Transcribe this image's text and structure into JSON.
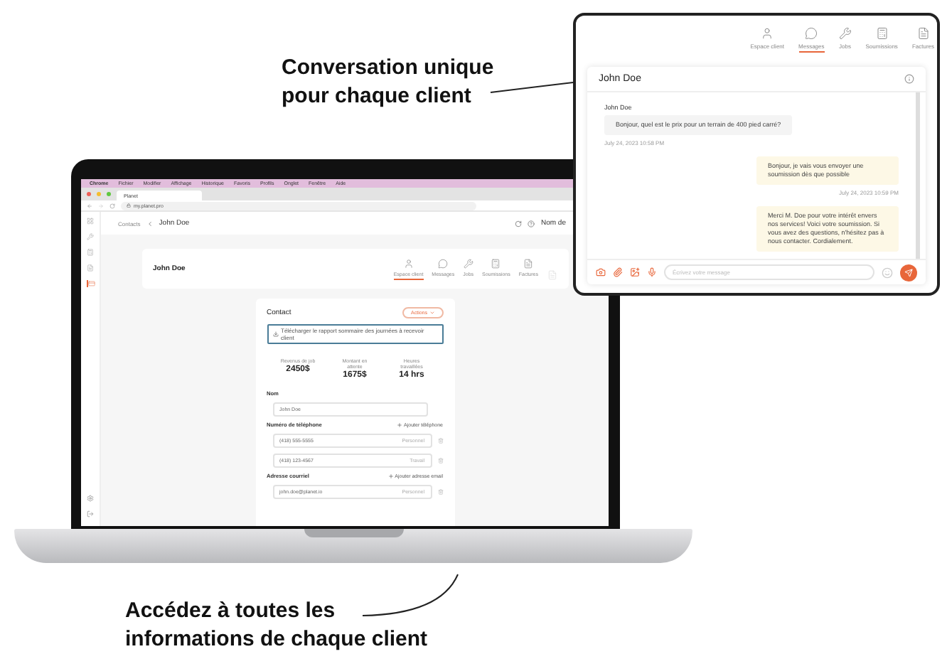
{
  "top_caption": {
    "lines": [
      "Conversation unique",
      "pour chaque client"
    ]
  },
  "bottom_caption": {
    "lines": [
      "Accédez à toutes les",
      "informations de chaque client"
    ]
  },
  "laptop": {
    "menu_bar": {
      "app": "Chrome",
      "items": [
        "Fichier",
        "Modifier",
        "Affichage",
        "Historique",
        "Favoris",
        "Profils",
        "Onglet",
        "Fenêtre",
        "Aide"
      ]
    },
    "browser_tab": {
      "title": "Planet"
    },
    "address": "my.planet.pro",
    "breadcrumb": {
      "parent": "Contacts",
      "current": "John Doe",
      "account": "Nom de"
    },
    "sidebar": [
      {
        "kind": "grid",
        "selected": false
      },
      {
        "kind": "tools",
        "selected": false
      },
      {
        "kind": "calc",
        "selected": false
      },
      {
        "kind": "file",
        "selected": false
      },
      {
        "kind": "card",
        "selected": true
      }
    ],
    "client_name": "John Doe",
    "tabs": [
      {
        "label": "Espace client",
        "kind": "user",
        "selected": true
      },
      {
        "label": "Messages",
        "kind": "chat",
        "selected": false
      },
      {
        "label": "Jobs",
        "kind": "tools",
        "selected": false
      },
      {
        "label": "Soumissions",
        "kind": "calc",
        "selected": false
      },
      {
        "label": "Factures",
        "kind": "file",
        "selected": false
      }
    ],
    "contact": {
      "title": "Contact",
      "actions": "Actions",
      "download": "Télécharger le rapport sommaire des journées à recevoir client",
      "stats": [
        {
          "label": "Revenus de job",
          "value": "2450$"
        },
        {
          "label": "Montant en attente",
          "value": "1675$"
        },
        {
          "label": "Heures travaillées",
          "value": "14 hrs"
        }
      ],
      "name_label": "Nom",
      "name_value": "John Doe",
      "phone_label": "Numéro de téléphone",
      "phone_add": "Ajouter téléphone",
      "phones": [
        {
          "value": "(418) 555-5555",
          "type": "Personnel"
        },
        {
          "value": "(418) 123-4567",
          "type": "Travail"
        }
      ],
      "email_label": "Adresse courriel",
      "email_add": "Ajouter adresse email",
      "emails": [
        {
          "value": "john.doe@planet.io",
          "type": "Personnel"
        }
      ]
    }
  },
  "chat_panel": {
    "tabs": [
      {
        "label": "Espace client",
        "kind": "user",
        "selected": false
      },
      {
        "label": "Messages",
        "kind": "chat",
        "selected": true
      },
      {
        "label": "Jobs",
        "kind": "tools",
        "selected": false
      },
      {
        "label": "Soumissions",
        "kind": "calc",
        "selected": false
      },
      {
        "label": "Factures",
        "kind": "file",
        "selected": false
      }
    ],
    "title": "John Doe",
    "messages": [
      {
        "kind": "in",
        "sender": "John Doe",
        "text": "Bonjour, quel est le prix pour un terrain de 400 pied carré?",
        "time": "July 24, 2023 10:58 PM"
      },
      {
        "kind": "out",
        "text": "Bonjour, je vais vous envoyer une soumission dès que possible",
        "time": "July 24, 2023 10:59 PM"
      },
      {
        "kind": "out",
        "text": "Merci M. Doe pour votre intérêt envers nos services! Voici votre soumission. Si vous avez des questions, n'hésitez pas à nous contacter. Cordialement."
      }
    ],
    "placeholder": "Écrivez votre message"
  }
}
